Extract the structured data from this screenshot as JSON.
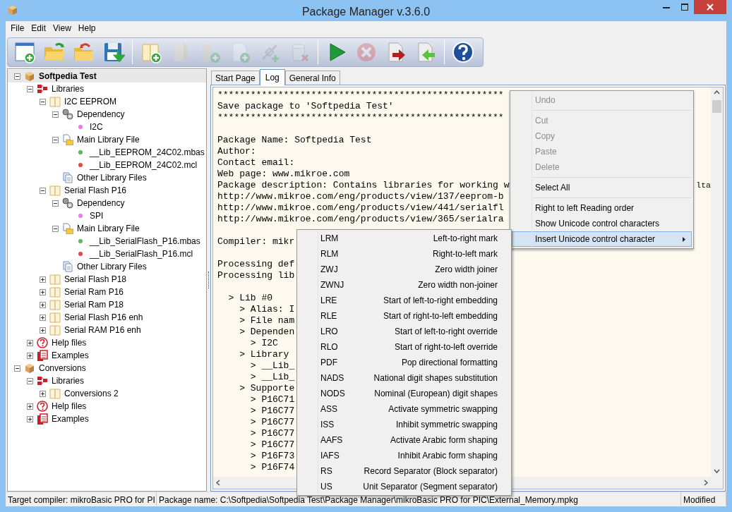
{
  "window": {
    "title": "Package Manager v.3.6.0"
  },
  "menu": [
    "File",
    "Edit",
    "View",
    "Help"
  ],
  "toolbar": [
    {
      "kind": "new",
      "disabled": false
    },
    {
      "kind": "open",
      "disabled": false
    },
    {
      "kind": "revert",
      "disabled": false
    },
    {
      "kind": "save",
      "disabled": false
    },
    {
      "kind": "separator"
    },
    {
      "kind": "book-add",
      "disabled": false
    },
    {
      "kind": "folder",
      "disabled": true
    },
    {
      "kind": "folder-add",
      "disabled": true
    },
    {
      "kind": "file-add",
      "disabled": true
    },
    {
      "kind": "link-add",
      "disabled": true
    },
    {
      "kind": "trash",
      "disabled": true
    },
    {
      "kind": "separator"
    },
    {
      "kind": "play",
      "disabled": false
    },
    {
      "kind": "cancel",
      "disabled": true
    },
    {
      "kind": "export",
      "disabled": false
    },
    {
      "kind": "import",
      "disabled": false
    },
    {
      "kind": "separator"
    },
    {
      "kind": "help",
      "disabled": false
    }
  ],
  "tree": [
    {
      "label": "Softpedia Test",
      "kind": "package",
      "expanded": true,
      "selected": true,
      "children": [
        {
          "label": "Libraries",
          "kind": "libraries",
          "expanded": true,
          "selected": false,
          "children": [
            {
              "label": "I2C EEPROM",
              "kind": "book",
              "expanded": true,
              "selected": false,
              "children": [
                {
                  "label": "Dependency",
                  "kind": "dependency",
                  "expanded": true,
                  "selected": false,
                  "children": [
                    {
                      "label": "I2C",
                      "kind": "dot",
                      "color": "#e87be8",
                      "selected": false
                    }
                  ]
                },
                {
                  "label": "Main Library File",
                  "kind": "mainfile",
                  "expanded": true,
                  "selected": false,
                  "children": [
                    {
                      "label": "__Lib_EEPROM_24C02.mbas",
                      "kind": "dot",
                      "color": "#5cb85c",
                      "selected": false
                    },
                    {
                      "label": "__Lib_EEPROM_24C02.mcl",
                      "kind": "dot",
                      "color": "#e04848",
                      "selected": false
                    }
                  ]
                },
                {
                  "label": "Other Library Files",
                  "kind": "otherfiles",
                  "selected": false
                }
              ]
            },
            {
              "label": "Serial Flash P16",
              "kind": "book",
              "expanded": true,
              "selected": false,
              "children": [
                {
                  "label": "Dependency",
                  "kind": "dependency",
                  "expanded": true,
                  "selected": false,
                  "children": [
                    {
                      "label": "SPI",
                      "kind": "dot",
                      "color": "#e87be8",
                      "selected": false
                    }
                  ]
                },
                {
                  "label": "Main Library File",
                  "kind": "mainfile",
                  "expanded": true,
                  "selected": false,
                  "children": [
                    {
                      "label": "__Lib_SerialFlash_P16.mbas",
                      "kind": "dot",
                      "color": "#5cb85c",
                      "selected": false
                    },
                    {
                      "label": "__Lib_SerialFlash_P16.mcl",
                      "kind": "dot",
                      "color": "#e04848",
                      "selected": false
                    }
                  ]
                },
                {
                  "label": "Other Library Files",
                  "kind": "otherfiles",
                  "selected": false
                }
              ]
            },
            {
              "label": "Serial Flash P18",
              "kind": "book",
              "expanded": false,
              "selected": false
            },
            {
              "label": "Serial Ram P16",
              "kind": "book",
              "expanded": false,
              "selected": false
            },
            {
              "label": "Serial Ram P18",
              "kind": "book",
              "expanded": false,
              "selected": false
            },
            {
              "label": "Serial Flash P16 enh",
              "kind": "book",
              "expanded": false,
              "selected": false
            },
            {
              "label": "Serial RAM P16 enh",
              "kind": "book",
              "expanded": false,
              "selected": false
            }
          ]
        },
        {
          "label": "Help files",
          "kind": "help",
          "expanded": false,
          "selected": false
        },
        {
          "label": "Examples",
          "kind": "examples",
          "expanded": false,
          "selected": false
        }
      ]
    },
    {
      "label": "Conversions",
      "kind": "package",
      "expanded": true,
      "selected": false,
      "children": [
        {
          "label": "Libraries",
          "kind": "libraries",
          "expanded": true,
          "selected": false,
          "children": [
            {
              "label": "Conversions 2",
              "kind": "book",
              "expanded": false,
              "selected": false
            }
          ]
        },
        {
          "label": "Help files",
          "kind": "help",
          "expanded": false,
          "selected": false
        },
        {
          "label": "Examples",
          "kind": "examples",
          "expanded": false,
          "selected": false
        }
      ]
    }
  ],
  "tabs": [
    {
      "label": "Start Page",
      "selected": false
    },
    {
      "label": "Log",
      "selected": true
    },
    {
      "label": "General Info",
      "selected": false
    }
  ],
  "log": [
    {
      "kind": "text",
      "text": "****************************************************"
    },
    {
      "kind": "text",
      "text": "Save package to 'Softpedia Test'"
    },
    {
      "kind": "text",
      "text": "****************************************************"
    },
    {
      "kind": "blank"
    },
    {
      "kind": "text",
      "text": "Package Name: Softpedia Test"
    },
    {
      "kind": "text",
      "text": "Author:"
    },
    {
      "kind": "text",
      "text": "Contact email:"
    },
    {
      "kind": "text",
      "text": "Web page: www.mikroe.com"
    },
    {
      "kind": "text",
      "text": "Package description: Contains libraries for working w",
      "tail": "lta"
    },
    {
      "kind": "text",
      "text": "http://www.mikroe.com/eng/products/view/137/eeprom-b"
    },
    {
      "kind": "text",
      "text": "http://www.mikroe.com/eng/products/view/441/serialfl"
    },
    {
      "kind": "text",
      "text": "http://www.mikroe.com/eng/products/view/365/serialra"
    },
    {
      "kind": "blank"
    },
    {
      "kind": "text",
      "text": "Compiler: mikr"
    },
    {
      "kind": "blank"
    },
    {
      "kind": "text",
      "text": "Processing def"
    },
    {
      "kind": "text",
      "text": "Processing lib"
    },
    {
      "kind": "blank"
    },
    {
      "kind": "text",
      "text": "  > Lib #0"
    },
    {
      "kind": "text",
      "text": "    > Alias: I"
    },
    {
      "kind": "text",
      "text": "    > File nam"
    },
    {
      "kind": "text",
      "text": "    > Dependen"
    },
    {
      "kind": "text",
      "text": "      > I2C"
    },
    {
      "kind": "text",
      "text": "    > Library"
    },
    {
      "kind": "text",
      "text": "      > __Lib_"
    },
    {
      "kind": "text",
      "text": "      > __Lib_"
    },
    {
      "kind": "text",
      "text": "    > Supporte"
    },
    {
      "kind": "text",
      "text": "      > P16C71"
    },
    {
      "kind": "text",
      "text": "      > P16C77"
    },
    {
      "kind": "text",
      "text": "      > P16C77"
    },
    {
      "kind": "text",
      "text": "      > P16C77"
    },
    {
      "kind": "text",
      "text": "      > P16C77"
    },
    {
      "kind": "text",
      "text": "      > P16F73"
    },
    {
      "kind": "text",
      "text": "      > P16F74"
    }
  ],
  "context_menu": [
    {
      "kind": "item",
      "label": "Undo",
      "disabled": true,
      "selected": false
    },
    {
      "kind": "separator"
    },
    {
      "kind": "item",
      "label": "Cut",
      "disabled": true,
      "selected": false
    },
    {
      "kind": "item",
      "label": "Copy",
      "disabled": true,
      "selected": false
    },
    {
      "kind": "item",
      "label": "Paste",
      "disabled": true,
      "selected": false
    },
    {
      "kind": "item",
      "label": "Delete",
      "disabled": true,
      "selected": false
    },
    {
      "kind": "separator"
    },
    {
      "kind": "item",
      "label": "Select All",
      "disabled": false,
      "selected": false
    },
    {
      "kind": "separator"
    },
    {
      "kind": "item",
      "label": "Right to left Reading order",
      "disabled": false,
      "selected": false
    },
    {
      "kind": "item",
      "label": "Show Unicode control characters",
      "disabled": false,
      "selected": false
    },
    {
      "kind": "submenu",
      "label": "Insert Unicode control character",
      "disabled": false,
      "selected": true
    }
  ],
  "submenu": [
    {
      "code": "LRM",
      "description": "Left-to-right mark"
    },
    {
      "code": "RLM",
      "description": "Right-to-left mark"
    },
    {
      "code": "ZWJ",
      "description": "Zero width joiner"
    },
    {
      "code": "ZWNJ",
      "description": "Zero width non-joiner"
    },
    {
      "code": "LRE",
      "description": "Start of left-to-right embedding"
    },
    {
      "code": "RLE",
      "description": "Start of right-to-left embedding"
    },
    {
      "code": "LRO",
      "description": "Start of left-to-right override"
    },
    {
      "code": "RLO",
      "description": "Start of right-to-left override"
    },
    {
      "code": "PDF",
      "description": "Pop directional formatting"
    },
    {
      "code": "NADS",
      "description": "National digit shapes substitution"
    },
    {
      "code": "NODS",
      "description": "Nominal (European) digit shapes"
    },
    {
      "code": "ASS",
      "description": "Activate symmetric swapping"
    },
    {
      "code": "ISS",
      "description": "Inhibit symmetric swapping"
    },
    {
      "code": "AAFS",
      "description": "Activate Arabic form shaping"
    },
    {
      "code": "IAFS",
      "description": "Inhibit Arabic form shaping"
    },
    {
      "code": "RS",
      "description": "Record Separator (Block separator)"
    },
    {
      "code": "US",
      "description": "Unit Separator (Segment separator)"
    }
  ],
  "status_bar": [
    "Target compiler: mikroBasic PRO for PI",
    "Package name: C:\\Softpedia\\Softpedia Test\\Package Manager\\mikroBasic PRO for PIC\\External_Memory.mpkg",
    "Modified"
  ]
}
